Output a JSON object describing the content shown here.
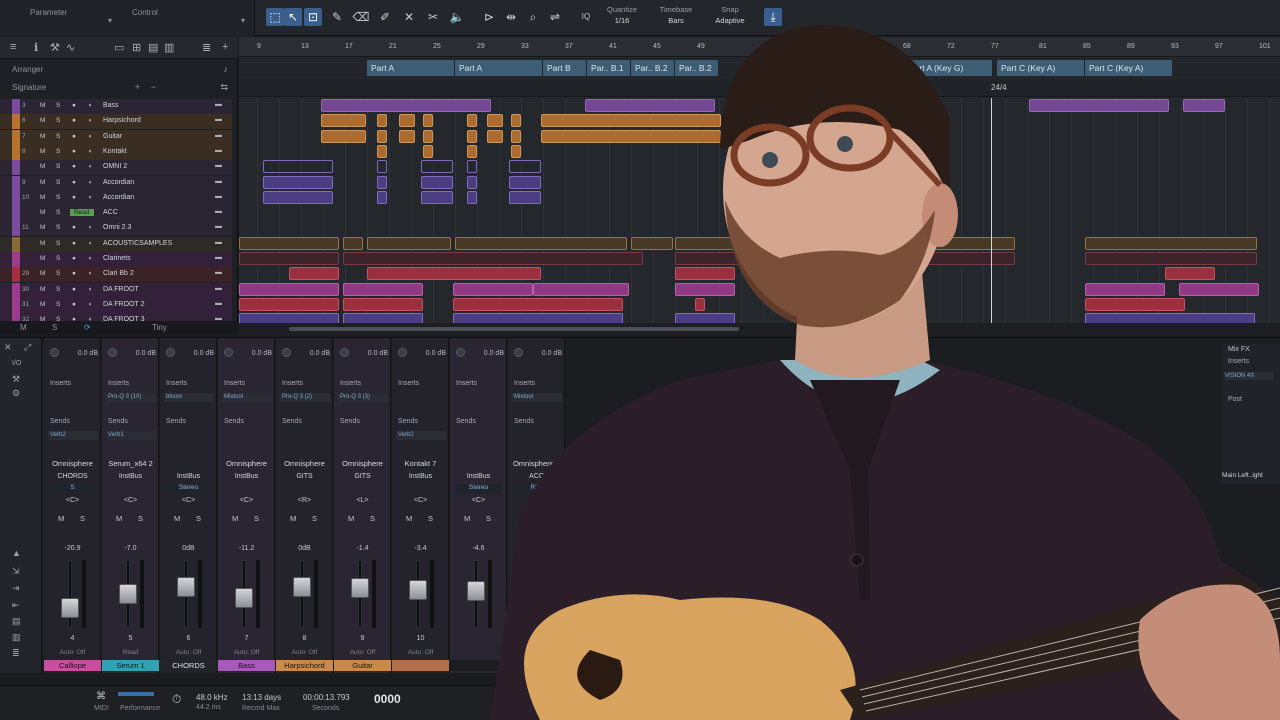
{
  "toolbar": {
    "parameter_label": "Parameter",
    "control_label": "Control",
    "quantize_label": "Quantize",
    "quantize_value": "1/16",
    "timebase_label": "Timebase",
    "timebase_value": "Bars",
    "snap_label": "Snap",
    "snap_value": "Adaptive",
    "iq_label": "IQ"
  },
  "left_panel": {
    "arranger_label": "Arranger",
    "signature_label": "Signature",
    "bottom_labels": [
      "M",
      "S",
      "Tiny"
    ]
  },
  "tracks": [
    {
      "num": "3",
      "name": "Bass",
      "color": "purple"
    },
    {
      "num": "6",
      "name": "Harpsichord",
      "color": "orange"
    },
    {
      "num": "7",
      "name": "Guitar",
      "color": "orange"
    },
    {
      "num": "8",
      "name": "Kontakt",
      "color": "orange"
    },
    {
      "num": "",
      "name": "OMNI 2",
      "color": "purple"
    },
    {
      "num": "9",
      "name": "Accordian",
      "color": "purple"
    },
    {
      "num": "10",
      "name": "Accordian",
      "color": "purple"
    },
    {
      "num": "",
      "name": "ACC",
      "color": "purple",
      "read": "Read"
    },
    {
      "num": "11",
      "name": "Omni 2.3",
      "color": "purple"
    },
    {
      "num": "",
      "name": "ACOUSTICSAMPLES",
      "color": "folder"
    },
    {
      "num": "",
      "name": "Clarinets",
      "color": "mag"
    },
    {
      "num": "29",
      "name": "Clari Bb 2",
      "color": "red"
    },
    {
      "num": "30",
      "name": "DA FROOT",
      "color": "mag"
    },
    {
      "num": "31",
      "name": "DA FROOT 2",
      "color": "mag"
    },
    {
      "num": "32",
      "name": "DA FROOT 3",
      "color": "mag"
    }
  ],
  "ruler": [
    "9",
    "13",
    "17",
    "21",
    "25",
    "29",
    "33",
    "37",
    "41",
    "45",
    "49",
    "81",
    "85",
    "89",
    "93",
    "97",
    "101"
  ],
  "ruler_extra": [
    "68",
    "72",
    "77"
  ],
  "sections": [
    "Part A",
    "Part A",
    "Part B",
    "Par.. B.1",
    "Par.. B.2",
    "Par.. B.2",
    "Part A (Key G)",
    "Part C (Key A)",
    "Part C (Key A)"
  ],
  "signature_value": "24/4",
  "console": {
    "side_labels": [
      "I/O"
    ],
    "strips": [
      {
        "gain": "0.0 dB",
        "plug": "",
        "send": "Verb2",
        "inst": "Omnisphere",
        "route": "CHORDS",
        "bus": "S",
        "pan": "<C>",
        "vol": "-20.9",
        "num": "4",
        "auto": "Auto: Off",
        "name": "Calliope",
        "color": "#c84ea0"
      },
      {
        "gain": "0.0 dB",
        "plug": "Pro-Q 3 (10)",
        "send": "Verb1",
        "inst": "Serum_x64 2",
        "route": "InstBus",
        "bus": "",
        "pan": "<C>",
        "vol": "-7.0",
        "num": "5",
        "auto": "Read",
        "name": "Serum 1",
        "color": "#2fa3b3"
      },
      {
        "gain": "0.0 dB",
        "plug": "bloom",
        "send": "",
        "inst": "",
        "route": "InstBus",
        "bus": "Stereo",
        "pan": "<C>",
        "vol": "0dB",
        "num": "6",
        "auto": "Auto: Off",
        "name": "CHORDS",
        "color": "#22252a"
      },
      {
        "gain": "0.0 dB",
        "plug": "Mixtool",
        "send": "",
        "inst": "Omnisphere",
        "route": "InstBus",
        "bus": "",
        "pan": "<C>",
        "vol": "-11.2",
        "num": "7",
        "auto": "Auto: Off",
        "name": "Bass",
        "color": "#a85ab8"
      },
      {
        "gain": "0.0 dB",
        "plug": "Pro-Q 3 (2)",
        "send": "",
        "inst": "Omnisphere",
        "route": "GITS",
        "bus": "",
        "pan": "<R>",
        "vol": "0dB",
        "num": "8",
        "auto": "Auto: Off",
        "name": "Harpsichord",
        "color": "#c98a4a"
      },
      {
        "gain": "0.0 dB",
        "plug": "Pro-Q 3 (3)",
        "send": "",
        "inst": "Omnisphere",
        "route": "GITS",
        "bus": "",
        "pan": "<L>",
        "vol": "-1.4",
        "num": "9",
        "auto": "Auto: Off",
        "name": "Guitar",
        "color": "#c98a4a"
      },
      {
        "gain": "0.0 dB",
        "plug": "",
        "send": "Verb2",
        "inst": "Kontakt 7",
        "route": "InstBus",
        "bus": "",
        "pan": "<C>",
        "vol": "-3.4",
        "num": "10",
        "auto": "Auto: Off",
        "name": "",
        "color": "#b36f4a"
      },
      {
        "gain": "0.0 dB",
        "plug": "",
        "send": "",
        "inst": "",
        "route": "InstBus",
        "bus": "Stereo",
        "pan": "<C>",
        "vol": "-4.6",
        "num": "",
        "auto": "",
        "name": "",
        "color": "#1b1d21"
      },
      {
        "gain": "0.0 dB",
        "plug": "Mixtool",
        "send": "",
        "inst": "Omnisphere 2",
        "route": "ACC",
        "bus": "R81",
        "pan": "",
        "vol": "0dB",
        "num": "",
        "auto": "",
        "name": "",
        "color": "#1b1d21"
      }
    ],
    "right_labels": [
      "Mix FX",
      "Inserts",
      "VISION 4X",
      "Post",
      "Main Left..ight"
    ]
  },
  "transport": {
    "midi": "MIDI",
    "performance": "Performance",
    "sample_rate": "48.0 kHz",
    "latency": "44.2 ms",
    "record_time": "13:13 days",
    "record_max": "Record Max",
    "timecode": "00:00:13.793",
    "seconds": "Seconds",
    "bars": "0000"
  }
}
